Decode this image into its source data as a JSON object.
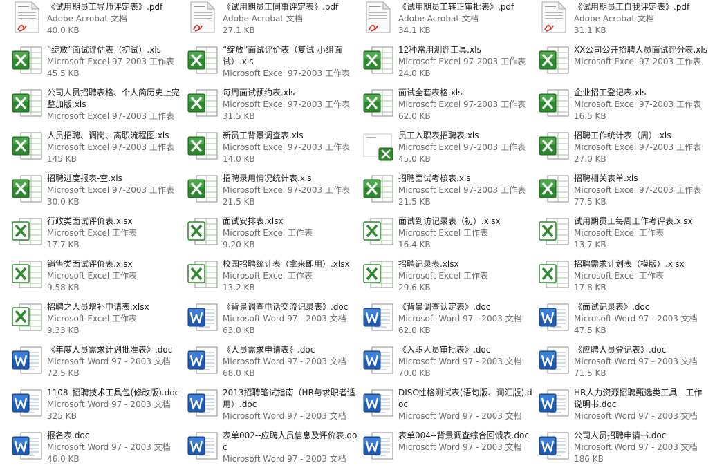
{
  "files": [
    {
      "name": "《试用期员工导师评定表》.pdf",
      "type": "Adobe Acrobat 文档",
      "size": "40.0 KB",
      "icon": "pdf-file-icon"
    },
    {
      "name": "《试用期员工同事评定表》.pdf",
      "type": "Adobe Acrobat 文档",
      "size": "27.1 KB",
      "icon": "pdf-file-icon"
    },
    {
      "name": "《试用期员工转正审批表》.pdf",
      "type": "Adobe Acrobat 文档",
      "size": "34.1 KB",
      "icon": "pdf-file-icon"
    },
    {
      "name": "《试用期员工自我评定表》.pdf",
      "type": "Adobe Acrobat 文档",
      "size": "31.1 KB",
      "icon": "pdf-file-icon"
    },
    {
      "name": "“绽放”面试评估表（初试）.xls",
      "type": "Microsoft Excel 97-2003 工作表",
      "size": "45.5 KB",
      "icon": "excel-file-icon"
    },
    {
      "name": "“绽放”面试评价表（复试-小组面试）.xls",
      "type": "Microsoft Excel 97-2003 工作表",
      "size": "",
      "icon": "excel-file-icon"
    },
    {
      "name": "12种常用测评工具.xls",
      "type": "Microsoft Excel 97-2003 工作表",
      "size": "24.0 KB",
      "icon": "excel-file-icon"
    },
    {
      "name": "XX公司公开招聘人员面试评分表.xls",
      "type": "Microsoft Excel 97-2003 工作表",
      "size": "",
      "icon": "excel-file-icon"
    },
    {
      "name": "公司人员招聘表格、个人简历史上完整加版.xls",
      "type": "Microsoft Excel 97-2003 工作表",
      "size": "",
      "icon": "excel-file-icon"
    },
    {
      "name": "每周面试预约表.xls",
      "type": "Microsoft Excel 97-2003 工作表",
      "size": "31.5 KB",
      "icon": "excel-file-icon"
    },
    {
      "name": "面试全套表格.xls",
      "type": "Microsoft Excel 97-2003 工作表",
      "size": "62.0 KB",
      "icon": "excel-file-icon"
    },
    {
      "name": "企业招工登记表.xls",
      "type": "Microsoft Excel 97-2003 工作表",
      "size": "16.5 KB",
      "icon": "excel-file-icon"
    },
    {
      "name": "人员招聘、调岗、离职流程图.xls",
      "type": "Microsoft Excel 97-2003 工作表",
      "size": "145 KB",
      "icon": "excel-file-icon"
    },
    {
      "name": "新员工背景调查表.xls",
      "type": "Microsoft Excel 97-2003 工作表",
      "size": "14.0 KB",
      "icon": "excel-file-icon"
    },
    {
      "name": "员工入职表招聘表.xls",
      "type": "Microsoft Excel 97-2003 工作表",
      "size": "45.0 KB",
      "icon": "excel-thumbnail-icon"
    },
    {
      "name": "招聘工作统计表（周）.xls",
      "type": "Microsoft Excel 97-2003 工作表",
      "size": "27.0 KB",
      "icon": "excel-file-icon"
    },
    {
      "name": "招聘进度报表-空.xls",
      "type": "Microsoft Excel 97-2003 工作表",
      "size": "30.0 KB",
      "icon": "excel-file-icon"
    },
    {
      "name": "招聘录用情况统计表.xls",
      "type": "Microsoft Excel 97-2003 工作表",
      "size": "21.5 KB",
      "icon": "excel-file-icon"
    },
    {
      "name": "招聘面试考核表.xls",
      "type": "Microsoft Excel 97-2003 工作表",
      "size": "21.5 KB",
      "icon": "excel-file-icon"
    },
    {
      "name": "招聘相关表单.xls",
      "type": "Microsoft Excel 97-2003 工作表",
      "size": "77.5 KB",
      "icon": "excel-file-icon"
    },
    {
      "name": "行政类面试评价表.xlsx",
      "type": "Microsoft Excel 工作表",
      "size": "17.7 KB",
      "icon": "excel-x-file-icon"
    },
    {
      "name": "面试安排表.xlsx",
      "type": "Microsoft Excel 工作表",
      "size": "9.20 KB",
      "icon": "excel-x-file-icon"
    },
    {
      "name": "面试到访记录表（初）.xlsx",
      "type": "Microsoft Excel 工作表",
      "size": "16.4 KB",
      "icon": "excel-x-file-icon"
    },
    {
      "name": "试用期员工每周工作考评表.xlsx",
      "type": "Microsoft Excel 工作表",
      "size": "13.7 KB",
      "icon": "excel-x-file-icon"
    },
    {
      "name": "销售类面试评价表.xlsx",
      "type": "Microsoft Excel 工作表",
      "size": "9.58 KB",
      "icon": "excel-x-file-icon"
    },
    {
      "name": "校园招聘统计表（拿来即用）.xlsx",
      "type": "Microsoft Excel 工作表",
      "size": "13.2 KB",
      "icon": "excel-x-file-icon"
    },
    {
      "name": "招聘记录表.xlsx",
      "type": "Microsoft Excel 工作表",
      "size": "29.6 KB",
      "icon": "excel-x-file-icon"
    },
    {
      "name": "招聘需求计划表（模版）.xlsx",
      "type": "Microsoft Excel 工作表",
      "size": "17.8 KB",
      "icon": "excel-x-file-icon"
    },
    {
      "name": "招聘之人员增补申请表.xlsx",
      "type": "Microsoft Excel 工作表",
      "size": "9.33 KB",
      "icon": "excel-x-file-icon"
    },
    {
      "name": "《背景调查电话交流记录表》.doc",
      "type": "Microsoft Word 97 - 2003 文档",
      "size": "63.0 KB",
      "icon": "word-file-icon"
    },
    {
      "name": "《背景调查认定表》.doc",
      "type": "Microsoft Word 97 - 2003 文档",
      "size": "62.0 KB",
      "icon": "word-file-icon"
    },
    {
      "name": "《面试记录表》.doc",
      "type": "Microsoft Word 97 - 2003 文档",
      "size": "47.5 KB",
      "icon": "word-file-icon"
    },
    {
      "name": "《年度人员需求计划批准表》.doc",
      "type": "Microsoft Word 97 - 2003 文档",
      "size": "72.5 KB",
      "icon": "word-file-icon"
    },
    {
      "name": "《人员需求申请表》.doc",
      "type": "Microsoft Word 97 - 2003 文档",
      "size": "68.0 KB",
      "icon": "word-file-icon"
    },
    {
      "name": "《入职人员审批表》.doc",
      "type": "Microsoft Word 97 - 2003 文档",
      "size": "70.0 KB",
      "icon": "word-file-icon"
    },
    {
      "name": "《应聘人员登记表》.doc",
      "type": "Microsoft Word 97 - 2003 文档",
      "size": "71.5 KB",
      "icon": "word-file-icon"
    },
    {
      "name": "1108_招聘技术工具包(修改版).doc",
      "type": "Microsoft Word 97 - 2003 文档",
      "size": "325 KB",
      "icon": "word-file-icon"
    },
    {
      "name": "2013招聘笔试指南（HR与求职者适用）.doc",
      "type": "Microsoft Word 97 - 2003 文档",
      "size": "",
      "icon": "word-file-icon"
    },
    {
      "name": "DISC性格测试表(语句版、词汇版).doc",
      "type": "Microsoft Word 97 - 2003 文档",
      "size": "",
      "icon": "word-file-icon"
    },
    {
      "name": "HR人力资源招聘甄选类工具—工作说明书.doc",
      "type": "Microsoft Word 97 - 2003 文档",
      "size": "",
      "icon": "word-file-icon"
    },
    {
      "name": "报名表.doc",
      "type": "Microsoft Word 97 - 2003 文档",
      "size": "46.0 KB",
      "icon": "word-file-icon"
    },
    {
      "name": "表单002--应聘人员信息及评价表.doc",
      "type": "Microsoft Word 97 - 2003 文档",
      "size": "",
      "icon": "word-file-icon"
    },
    {
      "name": "表单004--背景调查综合回馈表.doc",
      "type": "Microsoft Word 97 - 2003 文档",
      "size": "",
      "icon": "word-file-icon"
    },
    {
      "name": "公司人员招聘申请书.doc",
      "type": "Microsoft Word 97 - 2003 文档",
      "size": "186 KB",
      "icon": "word-file-icon"
    }
  ]
}
